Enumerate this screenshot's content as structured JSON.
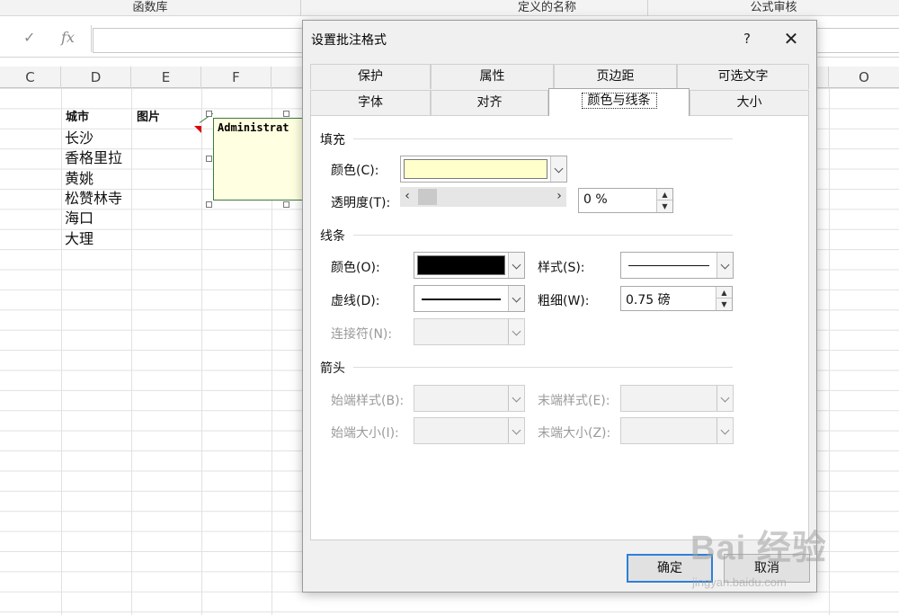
{
  "ribbon": {
    "groups": [
      "函数库",
      "定义的名称",
      "公式审核"
    ]
  },
  "formula_bar": {
    "cancel_icon": "check-icon",
    "fx_label": "fx",
    "value": ""
  },
  "sheet": {
    "columns": [
      "C",
      "D",
      "E",
      "F",
      "O"
    ],
    "header_city": "城市",
    "header_photo": "图片",
    "cities": [
      "长沙",
      "香格里拉",
      "黄姚",
      "松赞林寺",
      "海口",
      "大理"
    ],
    "comment_text": "Administrat"
  },
  "dialog": {
    "title": "设置批注格式",
    "help_label": "?",
    "close_label": "✕",
    "tabs_row1": [
      "保护",
      "属性",
      "页边距",
      "可选文字"
    ],
    "tabs_row2": [
      "字体",
      "对齐",
      "颜色与线条",
      "大小"
    ],
    "active_tab": "颜色与线条",
    "fill": {
      "section": "填充",
      "color_label": "颜色(C):",
      "color_value": "#ffffcc",
      "transparency_label": "透明度(T):",
      "transparency_value": "0 %"
    },
    "line": {
      "section": "线条",
      "color_label": "颜色(O):",
      "color_value": "#000000",
      "style_label": "样式(S):",
      "dash_label": "虚线(D):",
      "weight_label": "粗细(W):",
      "weight_value": "0.75 磅",
      "connector_label": "连接符(N):"
    },
    "arrows": {
      "section": "箭头",
      "begin_style": "始端样式(B):",
      "end_style": "末端样式(E):",
      "begin_size": "始端大小(I):",
      "end_size": "末端大小(Z):"
    },
    "ok_label": "确定",
    "cancel_label": "取消"
  },
  "watermark": {
    "text": "Bai 经验",
    "url": "jingyan.baidu.com"
  }
}
